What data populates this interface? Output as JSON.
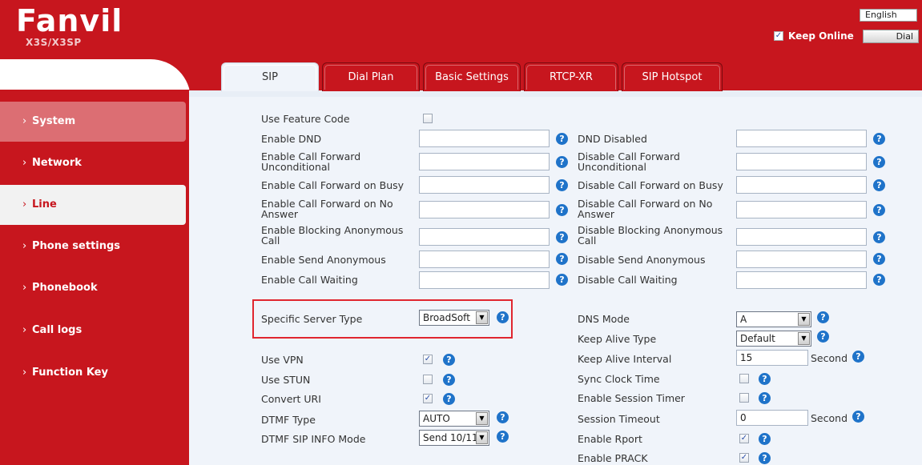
{
  "header": {
    "logo": "Fanvil",
    "model": "X3S/X3SP",
    "language": "English",
    "keep_online_label": "Keep Online",
    "keep_online_checked": true,
    "dial_label": "Dial",
    "brand_color": "#c7161e"
  },
  "tabs": [
    {
      "label": "SIP",
      "active": true
    },
    {
      "label": "Dial Plan",
      "active": false
    },
    {
      "label": "Basic Settings",
      "active": false
    },
    {
      "label": "RTCP-XR",
      "active": false
    },
    {
      "label": "SIP Hotspot",
      "active": false
    }
  ],
  "sidebar": {
    "items": [
      {
        "label": "System"
      },
      {
        "label": "Network"
      },
      {
        "label": "Line"
      },
      {
        "label": "Phone settings"
      },
      {
        "label": "Phonebook"
      },
      {
        "label": "Call logs"
      },
      {
        "label": "Function Key"
      }
    ]
  },
  "form": {
    "use_feature_code": "Use Feature Code",
    "left_codes": [
      "Enable DND",
      "Enable Call Forward Unconditional",
      "Enable Call Forward on Busy",
      "Enable Call Forward on No Answer",
      "Enable Blocking Anonymous Call",
      "Enable Send Anonymous",
      "Enable Call Waiting"
    ],
    "right_codes": [
      "DND Disabled",
      "Disable Call Forward Unconditional",
      "Disable Call Forward on Busy",
      "Disable Call Forward on No Answer",
      "Disable Blocking Anonymous Call",
      "Disable Send Anonymous",
      "Disable Call Waiting"
    ],
    "specific_server_type": {
      "label": "Specific Server Type",
      "value": "BroadSoft"
    },
    "use_vpn": "Use VPN",
    "use_stun": "Use STUN",
    "convert_uri": "Convert URI",
    "dtmf_type": {
      "label": "DTMF Type",
      "value": "AUTO"
    },
    "dtmf_sip_info_mode": {
      "label": "DTMF SIP INFO Mode",
      "value": "Send 10/11"
    },
    "dns_mode": {
      "label": "DNS Mode",
      "value": "A"
    },
    "keep_alive_type": {
      "label": "Keep Alive Type",
      "value": "Default"
    },
    "keep_alive_interval": {
      "label": "Keep Alive Interval",
      "value": "15",
      "unit": "Second"
    },
    "sync_clock_time": "Sync Clock Time",
    "enable_session_timer": "Enable Session Timer",
    "session_timeout": {
      "label": "Session Timeout",
      "value": "0",
      "unit": "Second"
    },
    "enable_rport": "Enable Rport",
    "enable_prack": "Enable PRACK",
    "checkbox_states": {
      "use_feature_code": false,
      "use_vpn": true,
      "use_stun": false,
      "convert_uri": true,
      "sync_clock_time": false,
      "enable_session_timer": false,
      "enable_rport": true,
      "enable_prack": true
    }
  },
  "icons": {
    "help": "help-icon",
    "check": "checkbox",
    "dropdown": "chevron-down-icon"
  }
}
